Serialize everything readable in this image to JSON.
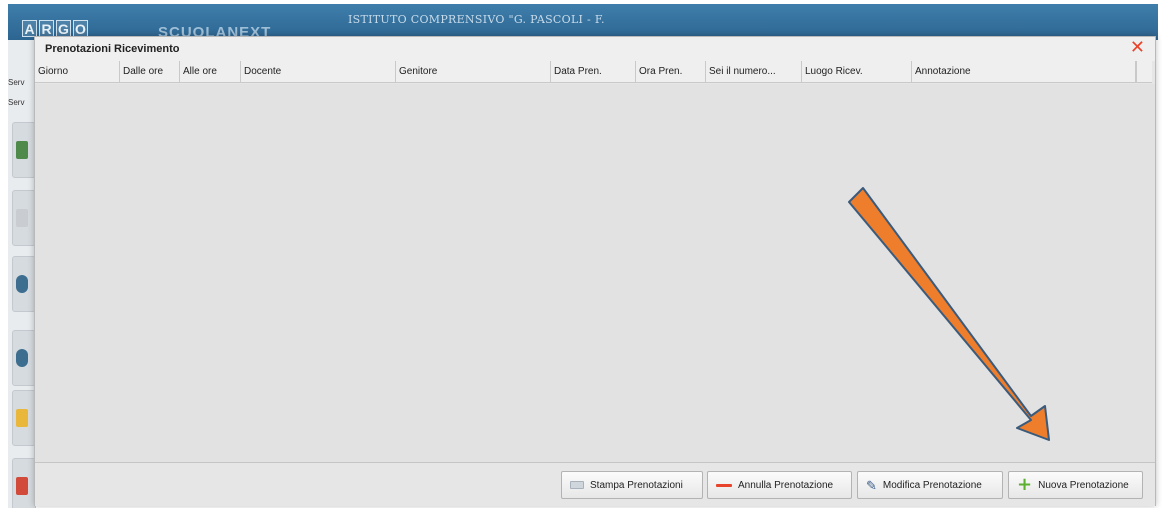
{
  "app": {
    "logo_letters": [
      "A",
      "R",
      "G",
      "O"
    ],
    "brand": "SCUOLANEXT",
    "school_name": "ISTITUTO COMPRENSIVO \"G. PASCOLI - F.",
    "sidebar_labels": [
      "Serv",
      "Serv"
    ]
  },
  "modal": {
    "title": "Prenotazioni Ricevimento",
    "close_icon": "close-icon",
    "columns": [
      {
        "label": "Giorno"
      },
      {
        "label": "Dalle ore"
      },
      {
        "label": "Alle ore"
      },
      {
        "label": "Docente"
      },
      {
        "label": "Genitore"
      },
      {
        "label": "Data Pren."
      },
      {
        "label": "Ora Pren."
      },
      {
        "label": "Sei il numero..."
      },
      {
        "label": "Luogo Ricev."
      },
      {
        "label": "Annotazione"
      }
    ],
    "rows": [],
    "buttons": {
      "print": {
        "label": "Stampa Prenotazioni",
        "icon": "printer-icon"
      },
      "cancel": {
        "label": "Annulla Prenotazione",
        "icon": "minus-icon"
      },
      "edit": {
        "label": "Modifica Prenotazione",
        "icon": "pencil-icon"
      },
      "new": {
        "label": "Nuova Prenotazione",
        "icon": "plus-icon"
      }
    }
  },
  "annotation": {
    "arrow_color": "#ee7d2c"
  },
  "colors": {
    "header_blue": "#3f7eab",
    "close_red": "#e8432b",
    "plus_green": "#5cb030"
  }
}
